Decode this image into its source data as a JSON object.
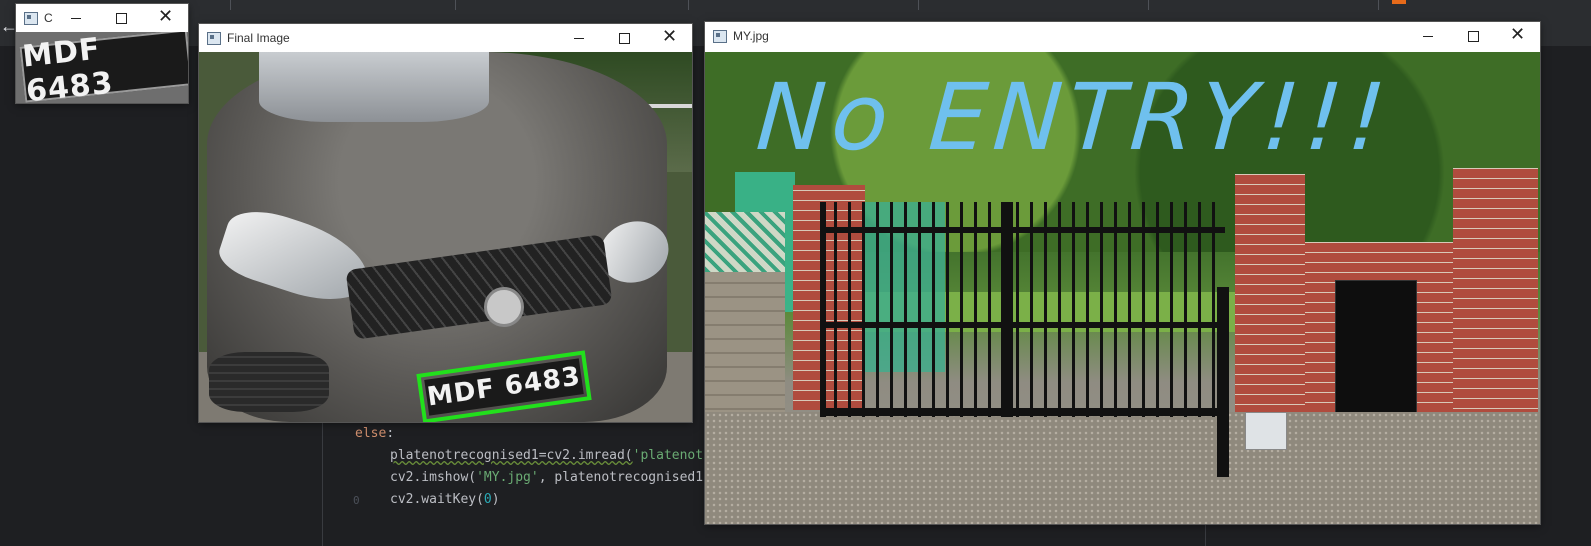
{
  "ide": {
    "back_arrow": "left-arrow-icon",
    "code": {
      "line1_kw": "else",
      "line1_rest": ":",
      "line2_a": "platenotrecognised1=cv2.imread(",
      "line2_str": "'platenot",
      "line3_a": "cv2.imshow(",
      "line3_str": "'MY.jpg'",
      "line3_b": ", platenotrecognised1",
      "line4_a": "cv2.waitKey(",
      "line4_num": "0",
      "line4_b": ")",
      "gutter_digit": "0"
    }
  },
  "windows": {
    "crop": {
      "title": "C",
      "plate_text": "MDF 6483"
    },
    "final": {
      "title": "Final Image",
      "plate_text": "MDF 6483",
      "box_color": "#22e01c"
    },
    "my": {
      "title": "MY.jpg",
      "overlay_text": "No ENTRY!!!",
      "overlay_color": "#6fc0ee"
    }
  },
  "icons": {
    "minimize": "minimize-icon",
    "maximize": "maximize-icon",
    "close": "close-icon",
    "app": "app-icon"
  }
}
